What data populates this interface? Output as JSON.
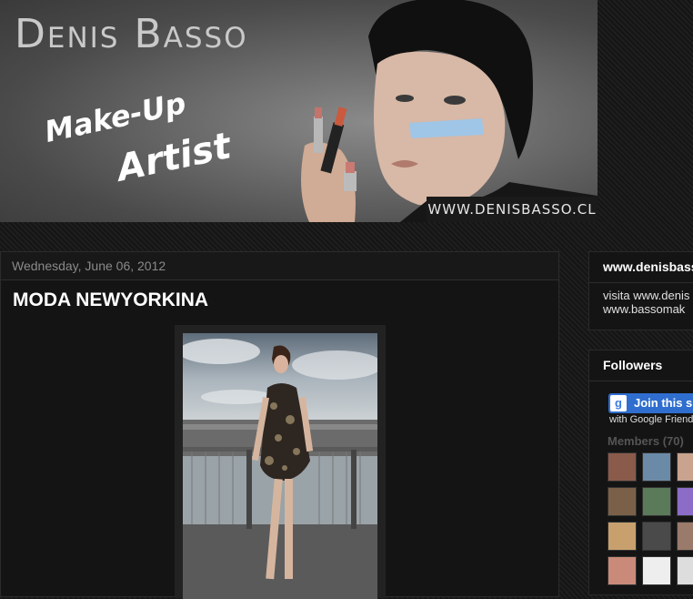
{
  "header": {
    "title": "Denis Basso",
    "tagline_line1": "Make-Up",
    "tagline_line2": "Artist",
    "url": "WWW.DENISBASSO.CL"
  },
  "post": {
    "date": "Wednesday, June 06, 2012",
    "title": "MODA NEWYORKINA"
  },
  "sidebar": {
    "widget1": {
      "title": "www.denisbasso",
      "line1": "visita www.denis",
      "line2": "www.bassomak"
    },
    "followers": {
      "title": "Followers",
      "join_label": "Join this s",
      "google_text": "with Google Friend",
      "members_label": "Members (70)"
    }
  },
  "colors": {
    "background": "#1b1b1b",
    "panel": "#141414",
    "join_button": "#2f6ecf"
  }
}
